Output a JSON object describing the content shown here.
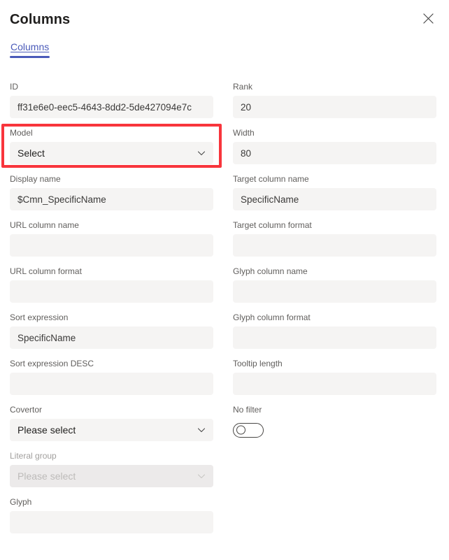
{
  "panel": {
    "title": "Columns",
    "close_label": "Close"
  },
  "tabs": [
    {
      "label": "Columns",
      "active": true
    }
  ],
  "fields": {
    "left": [
      {
        "name": "id",
        "label": "ID",
        "type": "text",
        "value": "ff31e6e0-eec5-4643-8dd2-5de427094e7c",
        "disabled": false
      },
      {
        "name": "model",
        "label": "Model",
        "type": "select",
        "value": "Select",
        "disabled": false,
        "highlighted": true
      },
      {
        "name": "display-name",
        "label": "Display name",
        "type": "text",
        "value": "$Cmn_SpecificName",
        "disabled": false
      },
      {
        "name": "url-column-name",
        "label": "URL column name",
        "type": "text",
        "value": "",
        "disabled": false
      },
      {
        "name": "url-column-format",
        "label": "URL column format",
        "type": "text",
        "value": "",
        "disabled": false
      },
      {
        "name": "sort-expression",
        "label": "Sort expression",
        "type": "text",
        "value": "SpecificName",
        "disabled": false
      },
      {
        "name": "sort-expression-desc",
        "label": "Sort expression DESC",
        "type": "text",
        "value": "",
        "disabled": false
      },
      {
        "name": "covertor",
        "label": "Covertor",
        "type": "select",
        "value": "Please select",
        "disabled": false
      },
      {
        "name": "literal-group",
        "label": "Literal group",
        "type": "select",
        "value": "Please select",
        "disabled": true
      },
      {
        "name": "glyph",
        "label": "Glyph",
        "type": "text",
        "value": "",
        "disabled": false
      }
    ],
    "right": [
      {
        "name": "rank",
        "label": "Rank",
        "type": "text",
        "value": "20",
        "disabled": false
      },
      {
        "name": "width",
        "label": "Width",
        "type": "text",
        "value": "80",
        "disabled": false
      },
      {
        "name": "target-column-name",
        "label": "Target column name",
        "type": "text",
        "value": "SpecificName",
        "disabled": false
      },
      {
        "name": "target-column-format",
        "label": "Target column format",
        "type": "text",
        "value": "",
        "disabled": false
      },
      {
        "name": "glyph-column-name",
        "label": "Glyph column name",
        "type": "text",
        "value": "",
        "disabled": false
      },
      {
        "name": "glyph-column-format",
        "label": "Glyph column format",
        "type": "text",
        "value": "",
        "disabled": false
      },
      {
        "name": "tooltip-length",
        "label": "Tooltip length",
        "type": "text",
        "value": "",
        "disabled": false
      },
      {
        "name": "no-filter",
        "label": "No filter",
        "type": "toggle",
        "value": "off",
        "disabled": false
      }
    ]
  },
  "icons": {
    "close": "close-icon",
    "chevron": "chevron-down-icon"
  },
  "colors": {
    "accent": "#4a5ab9",
    "highlight": "#f8353c",
    "field_bg": "#f5f4f3",
    "field_bg_disabled": "#eceaea",
    "label": "#605e5c"
  },
  "annotations": [
    {
      "name": "model-field-highlight",
      "target": "model",
      "color": "#f8353c"
    }
  ]
}
